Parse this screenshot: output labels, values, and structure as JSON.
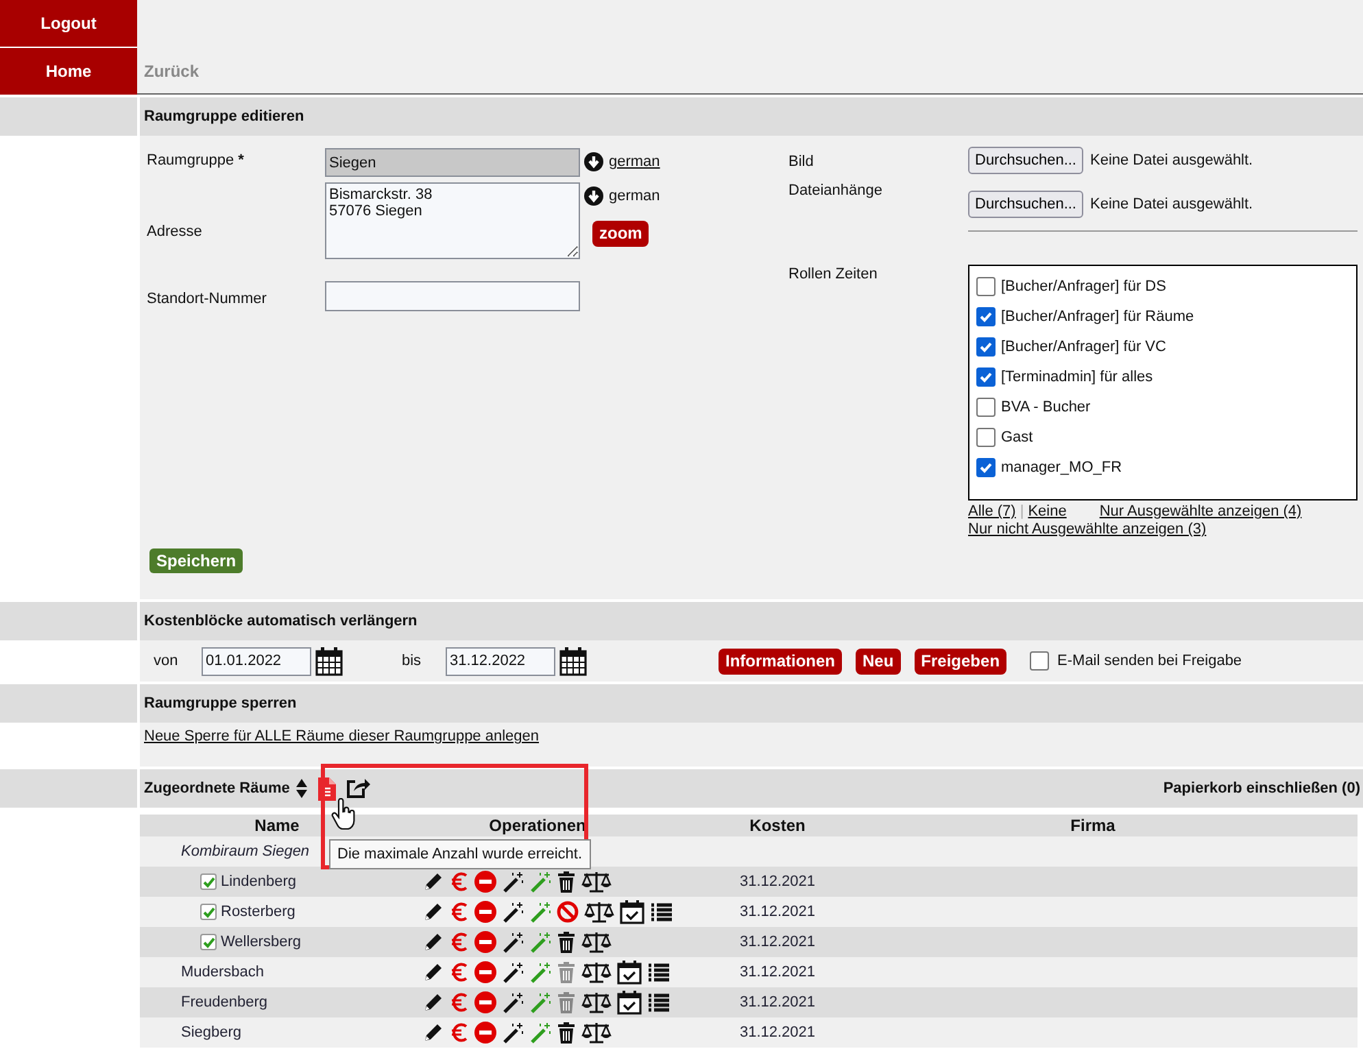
{
  "nav": {
    "logout": "Logout",
    "home": "Home",
    "back": "Zurück"
  },
  "edit": {
    "title": "Raumgruppe editieren",
    "name_field": {
      "label": "Raumgruppe",
      "required_mark": "*",
      "value": "Siegen",
      "language": {
        "text": "german",
        "kind": "link"
      }
    },
    "address_field": {
      "label": "Adresse",
      "value": "Bismarckstr. 38\n57076 Siegen",
      "language": {
        "text": "german",
        "kind": "label"
      },
      "zoom": "zoom"
    },
    "location_field": {
      "label": "Standort-Nummer"
    },
    "image": {
      "label": "Bild",
      "button": "Durchsuchen...",
      "status": "Keine Datei ausgewählt."
    },
    "attachments": {
      "label": "Dateianhänge",
      "button": "Durchsuchen...",
      "status": "Keine Datei ausgewählt."
    },
    "roles": {
      "label": "Rollen Zeiten",
      "items": [
        {
          "label": "[Bucher/Anfrager] für DS",
          "checked": false
        },
        {
          "label": "[Bucher/Anfrager] für Räume",
          "checked": true
        },
        {
          "label": "[Bucher/Anfrager] für VC",
          "checked": true
        },
        {
          "label": "[Terminadmin] für alles",
          "checked": true
        },
        {
          "label": "BVA - Bucher",
          "checked": false
        },
        {
          "label": "Gast",
          "checked": false
        },
        {
          "label": "manager_MO_FR",
          "checked": true
        }
      ],
      "all_link": "Alle (7)",
      "separator": "|",
      "none_link": "Keine",
      "selected_link": "Nur Ausgewählte anzeigen (4)",
      "unselected_link": "Nur nicht Ausgewählte anzeigen (3)"
    },
    "save": "Speichern"
  },
  "cost": {
    "title": "Kostenblöcke automatisch verlängern",
    "from_label": "von",
    "from": "01.01.2022",
    "to_label": "bis",
    "to": "31.12.2022",
    "buttons": [
      "Informationen",
      "Neu",
      "Freigeben"
    ],
    "email": {
      "label": "E-Mail senden bei Freigabe",
      "checked": false
    }
  },
  "lock": {
    "title": "Raumgruppe sperren",
    "link": "Neue Sperre für ALLE Räume dieser Raumgruppe anlegen"
  },
  "rooms": {
    "title": "Zugeordnete Räume",
    "trash_toggle": "Papierkorb einschließen (0)",
    "tooltip": "Die maximale Anzahl wurde erreicht.",
    "columns": [
      "Name",
      "Operationen",
      "Kosten",
      "Firma"
    ],
    "rows": [
      {
        "kind": "group",
        "name": "Kombiraum Siegen",
        "children": [
          {
            "kind": "room",
            "name": "Lindenberg",
            "checked": true,
            "cost": "31.12.2021",
            "actions": [
              {
                "kind": "edit",
                "disabled": false
              },
              {
                "kind": "euro",
                "disabled": false
              },
              {
                "kind": "block",
                "disabled": false
              },
              {
                "kind": "wand",
                "disabled": false
              },
              {
                "kind": "wand_green",
                "disabled": false
              },
              {
                "kind": "trash",
                "disabled": false
              },
              {
                "kind": "scales",
                "disabled": false
              }
            ]
          },
          {
            "kind": "room",
            "name": "Rosterberg",
            "checked": true,
            "cost": "31.12.2021",
            "actions": [
              {
                "kind": "edit",
                "disabled": false
              },
              {
                "kind": "euro",
                "disabled": false
              },
              {
                "kind": "block",
                "disabled": false
              },
              {
                "kind": "wand",
                "disabled": false
              },
              {
                "kind": "wand_green",
                "disabled": false
              },
              {
                "kind": "forbidden",
                "disabled": false
              },
              {
                "kind": "scales",
                "disabled": false
              },
              {
                "kind": "calendar",
                "disabled": false
              },
              {
                "kind": "list",
                "disabled": false
              }
            ]
          },
          {
            "kind": "room",
            "name": "Wellersberg",
            "checked": true,
            "cost": "31.12.2021",
            "actions": [
              {
                "kind": "edit",
                "disabled": false
              },
              {
                "kind": "euro",
                "disabled": false
              },
              {
                "kind": "block",
                "disabled": false
              },
              {
                "kind": "wand",
                "disabled": false
              },
              {
                "kind": "wand_green",
                "disabled": false
              },
              {
                "kind": "trash",
                "disabled": false
              },
              {
                "kind": "scales",
                "disabled": false
              }
            ]
          }
        ]
      },
      {
        "kind": "room",
        "name": "Mudersbach",
        "cost": "31.12.2021",
        "actions": [
          {
            "kind": "edit",
            "disabled": false
          },
          {
            "kind": "euro",
            "disabled": false
          },
          {
            "kind": "block",
            "disabled": false
          },
          {
            "kind": "wand",
            "disabled": false
          },
          {
            "kind": "wand_green",
            "disabled": false
          },
          {
            "kind": "trash",
            "disabled": true
          },
          {
            "kind": "scales",
            "disabled": false
          },
          {
            "kind": "calendar",
            "disabled": false
          },
          {
            "kind": "list",
            "disabled": false
          }
        ]
      },
      {
        "kind": "room",
        "name": "Freudenberg",
        "cost": "31.12.2021",
        "actions": [
          {
            "kind": "edit",
            "disabled": false
          },
          {
            "kind": "euro",
            "disabled": false
          },
          {
            "kind": "block",
            "disabled": false
          },
          {
            "kind": "wand",
            "disabled": false
          },
          {
            "kind": "wand_green",
            "disabled": false
          },
          {
            "kind": "trash",
            "disabled": true
          },
          {
            "kind": "scales",
            "disabled": false
          },
          {
            "kind": "calendar",
            "disabled": false
          },
          {
            "kind": "list",
            "disabled": false
          }
        ]
      },
      {
        "kind": "room",
        "name": "Siegberg",
        "cost": "31.12.2021",
        "actions": [
          {
            "kind": "edit",
            "disabled": false
          },
          {
            "kind": "euro",
            "disabled": false
          },
          {
            "kind": "block",
            "disabled": false
          },
          {
            "kind": "wand",
            "disabled": false
          },
          {
            "kind": "wand_green",
            "disabled": false
          },
          {
            "kind": "trash",
            "disabled": false
          },
          {
            "kind": "scales",
            "disabled": false
          }
        ]
      }
    ]
  }
}
